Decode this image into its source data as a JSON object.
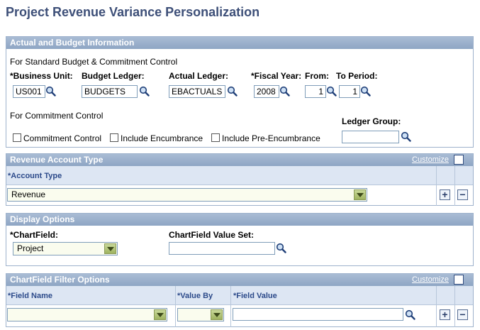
{
  "page": {
    "title": "Project Revenue Variance Personalization"
  },
  "actual_budget": {
    "header": "Actual and Budget Information",
    "std_caption": "For Standard Budget & Commitment Control",
    "business_unit_label": "*Business Unit:",
    "business_unit_value": "US001",
    "budget_ledger_label": "Budget Ledger:",
    "budget_ledger_value": "BUDGETS",
    "actual_ledger_label": "Actual Ledger:",
    "actual_ledger_value": "EBACTUALS",
    "fiscal_year_label": "*Fiscal Year:",
    "fiscal_year_value": "2008",
    "from_label": "From:",
    "from_value": "1",
    "to_period_label": "To Period:",
    "to_period_value": "1",
    "cc_caption": "For Commitment Control",
    "ledger_group_label": "Ledger Group:",
    "ledger_group_value": "",
    "commitment_control_label": "Commitment Control",
    "include_encumbrance_label": "Include Encumbrance",
    "include_pre_encumbrance_label": "Include Pre-Encumbrance"
  },
  "revenue_account": {
    "header": "Revenue Account Type",
    "customize": "Customize",
    "col_account_type": "*Account Type",
    "row_value": "Revenue"
  },
  "display_options": {
    "header": "Display Options",
    "chartfield_label": "*ChartField:",
    "chartfield_value": "Project",
    "value_set_label": "ChartField Value Set:",
    "value_set_value": ""
  },
  "filter_options": {
    "header": "ChartField Filter Options",
    "customize": "Customize",
    "col_field_name": "*Field Name",
    "col_value_by": "*Value By",
    "col_field_value": "*Field Value",
    "field_name_value": "",
    "value_by_value": "",
    "field_value_value": ""
  },
  "buttons": {
    "add": "+",
    "delete": "−"
  },
  "colors": {
    "title": "#3d4f78",
    "panel_header": "#8ea5c4",
    "column_header": "#2c4a8a"
  }
}
